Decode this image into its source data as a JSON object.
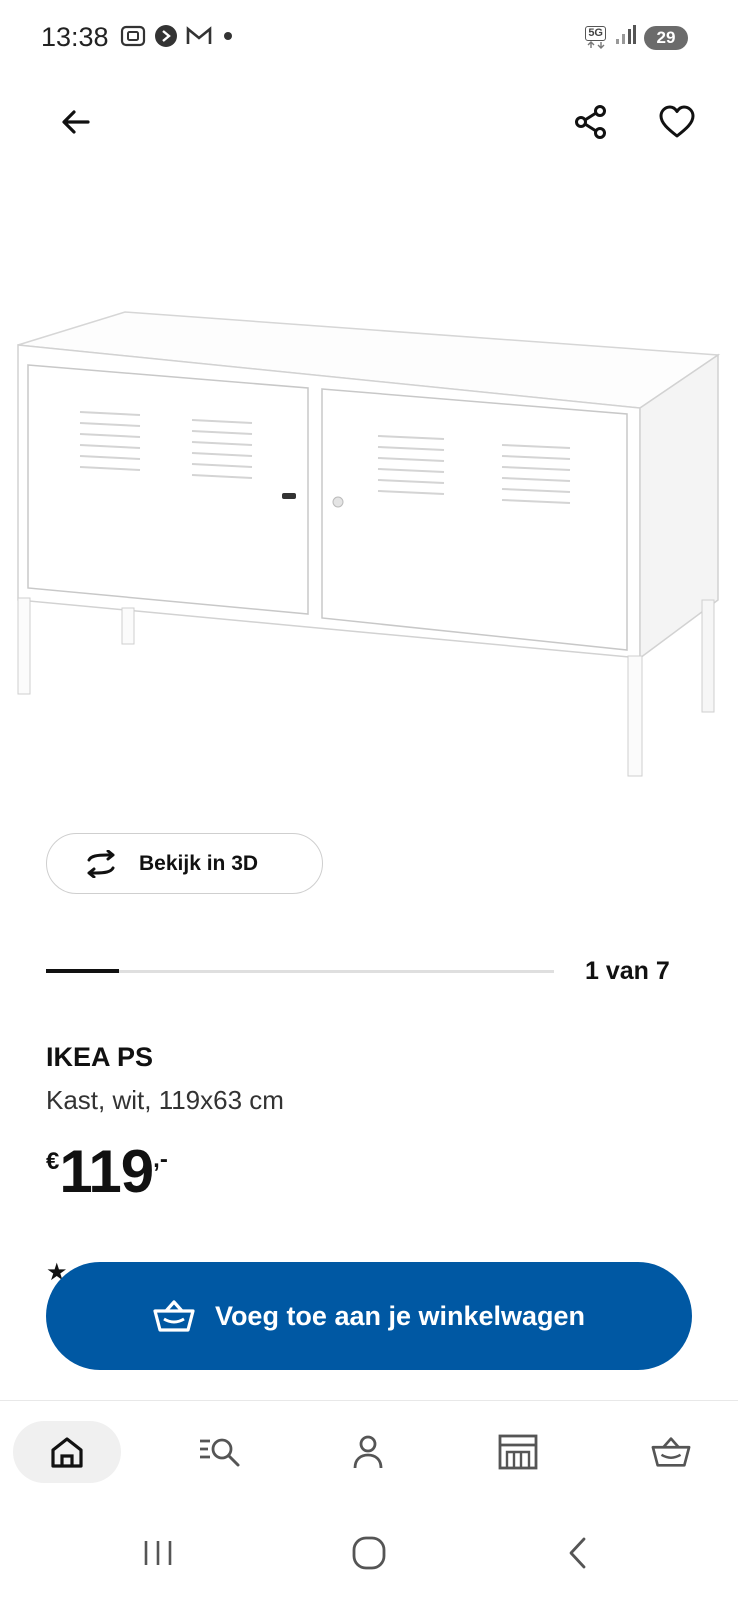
{
  "status_bar": {
    "time": "13:38",
    "network": "5G",
    "battery": "29",
    "left_icons": [
      "screenshot-icon",
      "media-icon",
      "gmail-icon",
      "dot-icon"
    ],
    "right_icons": [
      "5g-icon",
      "signal-icon",
      "battery-icon"
    ]
  },
  "app_bar": {
    "icons": [
      "back-arrow-icon",
      "share-icon",
      "heart-icon"
    ]
  },
  "view3d": {
    "label": "Bekijk in 3D",
    "icon": "rotate-3d-icon"
  },
  "carousel": {
    "position_label": "1 van 7",
    "current": 1,
    "total": 7
  },
  "product": {
    "name": "IKEA PS",
    "description": "Kast, wit, 119x63 cm",
    "price_currency": "€",
    "price_value": "119",
    "price_cents": ",-"
  },
  "cart_button": {
    "label": "Voeg toe aan je winkelwagen",
    "icon": "basket-icon",
    "color": "#0058a3"
  },
  "bottom_nav": {
    "items": [
      {
        "name": "home",
        "icon": "home-icon",
        "active": true
      },
      {
        "name": "search",
        "icon": "search-list-icon",
        "active": false
      },
      {
        "name": "account",
        "icon": "person-icon",
        "active": false
      },
      {
        "name": "stores",
        "icon": "store-icon",
        "active": false
      },
      {
        "name": "cart",
        "icon": "basket-icon",
        "active": false
      }
    ]
  },
  "system_nav": {
    "icons": [
      "recent-apps-icon",
      "home-circle-icon",
      "back-chevron-icon"
    ]
  }
}
